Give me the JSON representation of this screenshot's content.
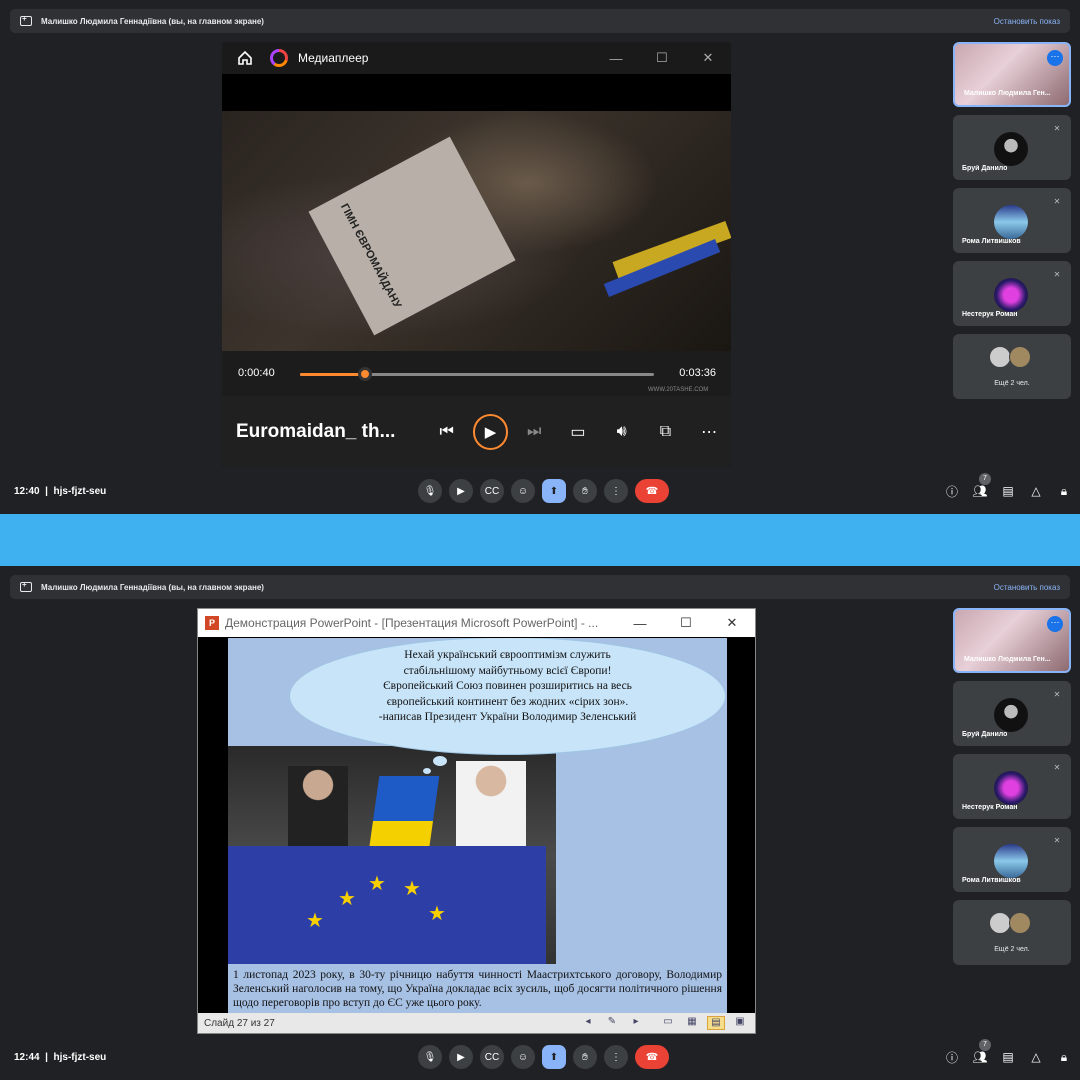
{
  "top": {
    "presenter": "Малишко Людмила Геннадіївна (вы, на главном экране)",
    "stop_label": "Остановить показ",
    "player": {
      "app_name": "Медиаплеер",
      "current_time": "0:00:40",
      "total_time": "0:03:36",
      "progress": 0.185,
      "track_title": "Euromaidan_ th...",
      "video_text": "ГІМН ЄВРОМАЙДАНУ",
      "watermark": "WWW.20TASHE.COM"
    },
    "time": "12:40",
    "meeting_code": "hjs-fjzt-seu",
    "participants_badge": "7"
  },
  "bottom": {
    "presenter": "Малишко Людмила Геннадіївна (вы, на главном экране)",
    "stop_label": "Остановить показ",
    "ppt": {
      "title": "Демонстрация PowerPoint - [Презентация Microsoft PowerPoint] - ...",
      "logo": "P",
      "cloud_lines": [
        "Нехай український єврооптимізм служить",
        "стабільнішому майбутньому всієї Європи!",
        "Європейський Союз повинен розширитись на весь",
        "європейський континент без жодних «сірих зон».",
        "-написав Президент України Володимир Зеленський"
      ],
      "caption": "1 листопад 2023 року, в 30-ту річницю набуття чинності Маастрихтського договору, Володимир Зеленський наголосив на тому, що Україна докладає всіх зусиль, щоб досягти політичного рішення щодо переговорів про вступ до ЄС уже цього року.",
      "status": "Слайд 27 из 27"
    },
    "time": "12:44",
    "meeting_code": "hjs-fjzt-seu",
    "participants_badge": "7"
  },
  "participants_top": [
    {
      "name": "Малишко Людмила Ген..."
    },
    {
      "name": "Бруй Данило"
    },
    {
      "name": "Рома Литвишков"
    },
    {
      "name": "Нестерук Роман"
    }
  ],
  "participants_bottom": [
    {
      "name": "Малишко Людмила Ген..."
    },
    {
      "name": "Бруй Данило"
    },
    {
      "name": "Нестерук Роман"
    },
    {
      "name": "Рома Литвишков"
    }
  ],
  "more_label": "Ещё 2 чел.",
  "colors": {
    "accent": "#8ab4f8",
    "end_call": "#ea4335",
    "divider": "#3fb0f0",
    "player_accent": "#ff8a30"
  }
}
